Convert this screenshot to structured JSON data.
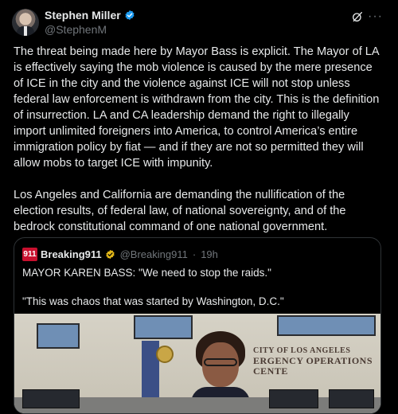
{
  "post": {
    "author_name": "Stephen Miller",
    "author_handle": "@StephenM",
    "icons": [
      "verified-badge-icon",
      "grok-icon",
      "more-options-icon"
    ],
    "more_glyph": "···",
    "body": "The threat being made here by Mayor Bass is explicit. The Mayor of LA is effectively saying the mob violence is caused by the mere presence of ICE in the city and the violence against ICE will not stop unless federal law enforcement is withdrawn from the city. This is the definition of insurrection. LA and CA leadership demand the right to illegally import unlimited foreigners into America, to control America’s entire immigration policy by fiat — and if they are not so permitted they will allow mobs to target ICE with impunity.\n\nLos Angeles and California are demanding the nullification of the election results, of federal law, of national sovereignty, and of the bedrock constitutional command of one national government."
  },
  "quote": {
    "logo_text": "911",
    "author_name": "Breaking911",
    "author_handle": "@Breaking911",
    "separator": "·",
    "time": "19h",
    "text": "MAYOR KAREN BASS: \"We need to stop the raids.\"\n\n\"This was chaos that was started by Washington, D.C.\"",
    "media": {
      "sign_line1": "CITY OF LOS ANGELES",
      "sign_line2": "ERGENCY OPERATIONS CENTE"
    }
  },
  "colors": {
    "background": "#000000",
    "text": "#e7e9ea",
    "muted": "#71767b",
    "verified_blue": "#1d9bf0",
    "verified_gold": "#e2b719",
    "border": "#2f3336",
    "breaking_red": "#c8102e"
  }
}
